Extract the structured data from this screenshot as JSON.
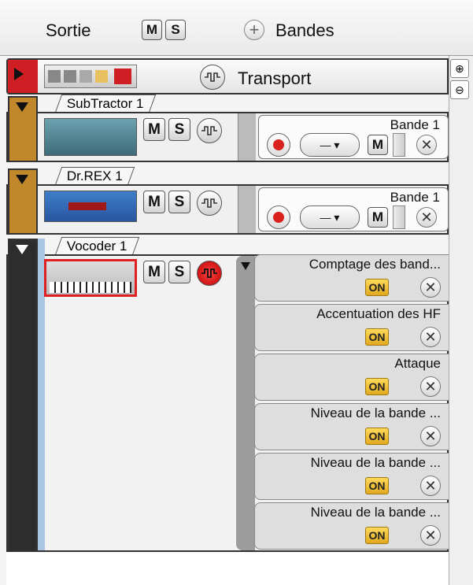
{
  "header": {
    "output_label": "Sortie",
    "mute_label": "M",
    "solo_label": "S",
    "add_lanes_label": "Bandes"
  },
  "transport": {
    "name": "Transport"
  },
  "devices": [
    {
      "name": "SubTractor 1",
      "color": "#c0882a",
      "mute": "M",
      "solo": "S",
      "lane": {
        "name": "Bande 1",
        "selector": "—",
        "mute": "M"
      }
    },
    {
      "name": "Dr.REX 1",
      "color": "#c0882a",
      "mute": "M",
      "solo": "S",
      "lane": {
        "name": "Bande 1",
        "selector": "—",
        "mute": "M"
      }
    },
    {
      "name": "Vocoder 1",
      "color": "#2d2d2d",
      "mute": "M",
      "solo": "S",
      "automation_lanes": [
        {
          "name": "Comptage des band...",
          "state": "ON"
        },
        {
          "name": "Accentuation des HF",
          "state": "ON"
        },
        {
          "name": "Attaque",
          "state": "ON"
        },
        {
          "name": "Niveau de la bande ...",
          "state": "ON"
        },
        {
          "name": "Niveau de la bande ...",
          "state": "ON"
        },
        {
          "name": "Niveau de la bande ...",
          "state": "ON"
        }
      ]
    }
  ],
  "zoom": {
    "in_icon": "zoom-in-icon",
    "out_icon": "zoom-out-icon"
  },
  "colors": {
    "record": "#d9221d",
    "on_button": "#f0c040",
    "selected_border": "#e02020"
  }
}
